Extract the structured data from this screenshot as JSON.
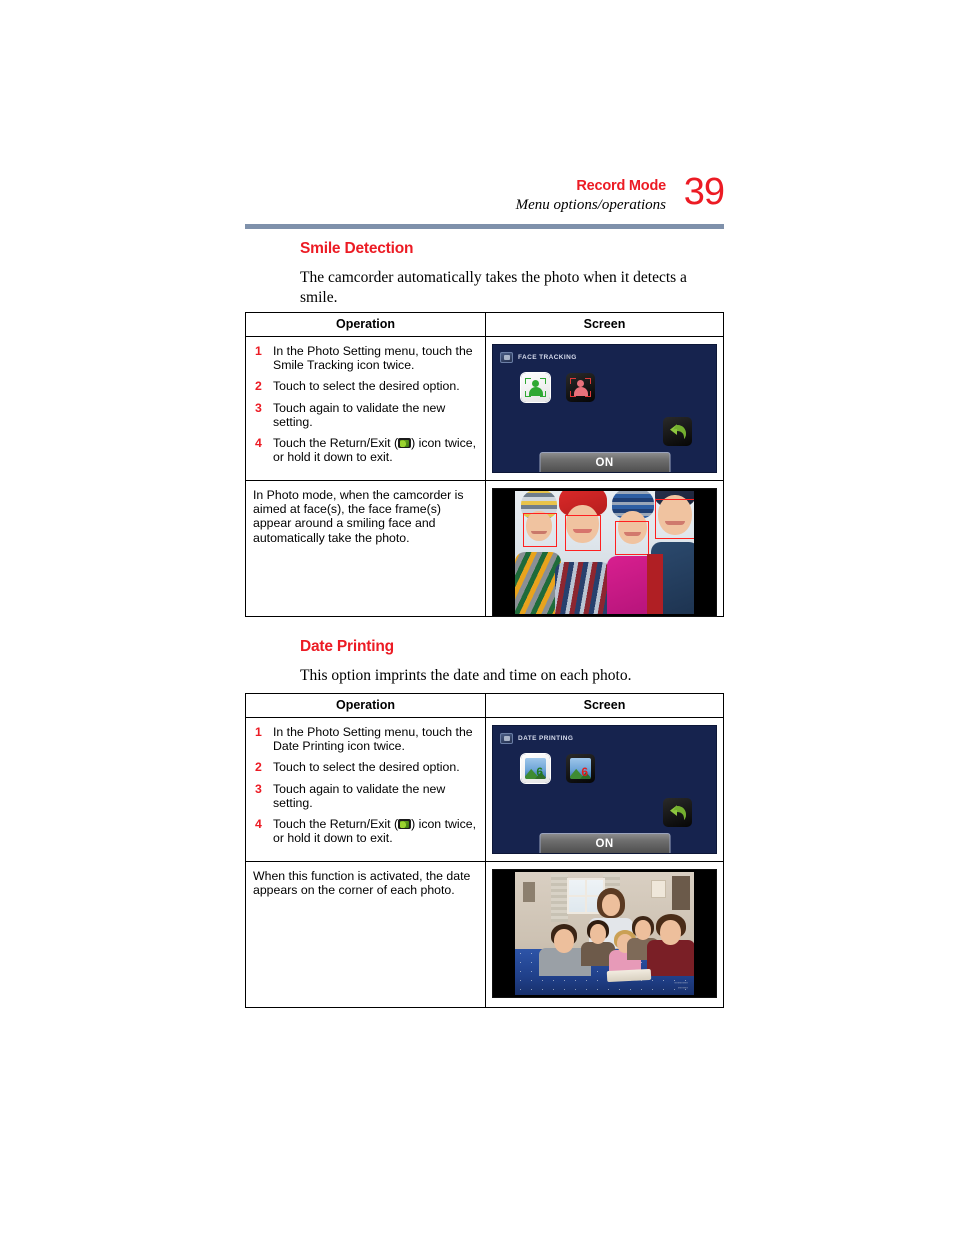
{
  "header": {
    "title": "Record Mode",
    "subtitle": "Menu options/operations",
    "page_number": "39",
    "rule_color": "#7f91ab",
    "accent_color": "#ec1b24"
  },
  "sections": [
    {
      "heading": "Smile Detection",
      "intro": "The camcorder automatically takes the photo when it detects a smile.",
      "table": {
        "columns": [
          "Operation",
          "Screen"
        ],
        "steps": [
          {
            "num": "1",
            "text_before": "In the Photo Setting menu, touch the Smile Tracking icon twice.",
            "icon": null,
            "text_after": ""
          },
          {
            "num": "2",
            "text_before": "Touch to select the desired option.",
            "icon": null,
            "text_after": ""
          },
          {
            "num": "3",
            "text_before": "Touch again to validate the new setting.",
            "icon": null,
            "text_after": ""
          },
          {
            "num": "4",
            "text_before": "Touch the Return/Exit (",
            "icon": "return-exit-icon",
            "text_after": ") icon twice, or hold it down to exit."
          }
        ],
        "screen": {
          "menu_label": "FACE TRACKING",
          "status_label": "ON",
          "option_selected": "face-tracking-on-icon",
          "option_unselected": "face-tracking-off-icon",
          "return_icon": "return-exit-icon",
          "background_color": "#16234e"
        },
        "note": "In Photo mode, when the camcorder is aimed at face(s), the face frame(s) appear around a smiling face and automatically take the photo.",
        "photo_caption": "family-with-face-detection-frames"
      }
    },
    {
      "heading": "Date Printing",
      "intro": "This option imprints the date and time on each photo.",
      "table": {
        "columns": [
          "Operation",
          "Screen"
        ],
        "steps": [
          {
            "num": "1",
            "text_before": "In the Photo Setting menu, touch the Date Printing icon twice.",
            "icon": null,
            "text_after": ""
          },
          {
            "num": "2",
            "text_before": "Touch to select the desired option.",
            "icon": null,
            "text_after": ""
          },
          {
            "num": "3",
            "text_before": "Touch again to validate the new setting.",
            "icon": null,
            "text_after": ""
          },
          {
            "num": "4",
            "text_before": "Touch the Return/Exit (",
            "icon": "return-exit-icon",
            "text_after": ") icon twice, or hold it down to exit."
          }
        ],
        "screen": {
          "menu_label": "DATE PRINTING",
          "status_label": "ON",
          "option_selected": "date-printing-on-icon",
          "option_unselected": "date-printing-off-icon",
          "return_icon": "return-exit-icon",
          "background_color": "#16234e"
        },
        "note": "When this function is activated, the date appears on the corner of each photo.",
        "photo_caption": "family-on-bed-with-date-stamp"
      }
    }
  ]
}
